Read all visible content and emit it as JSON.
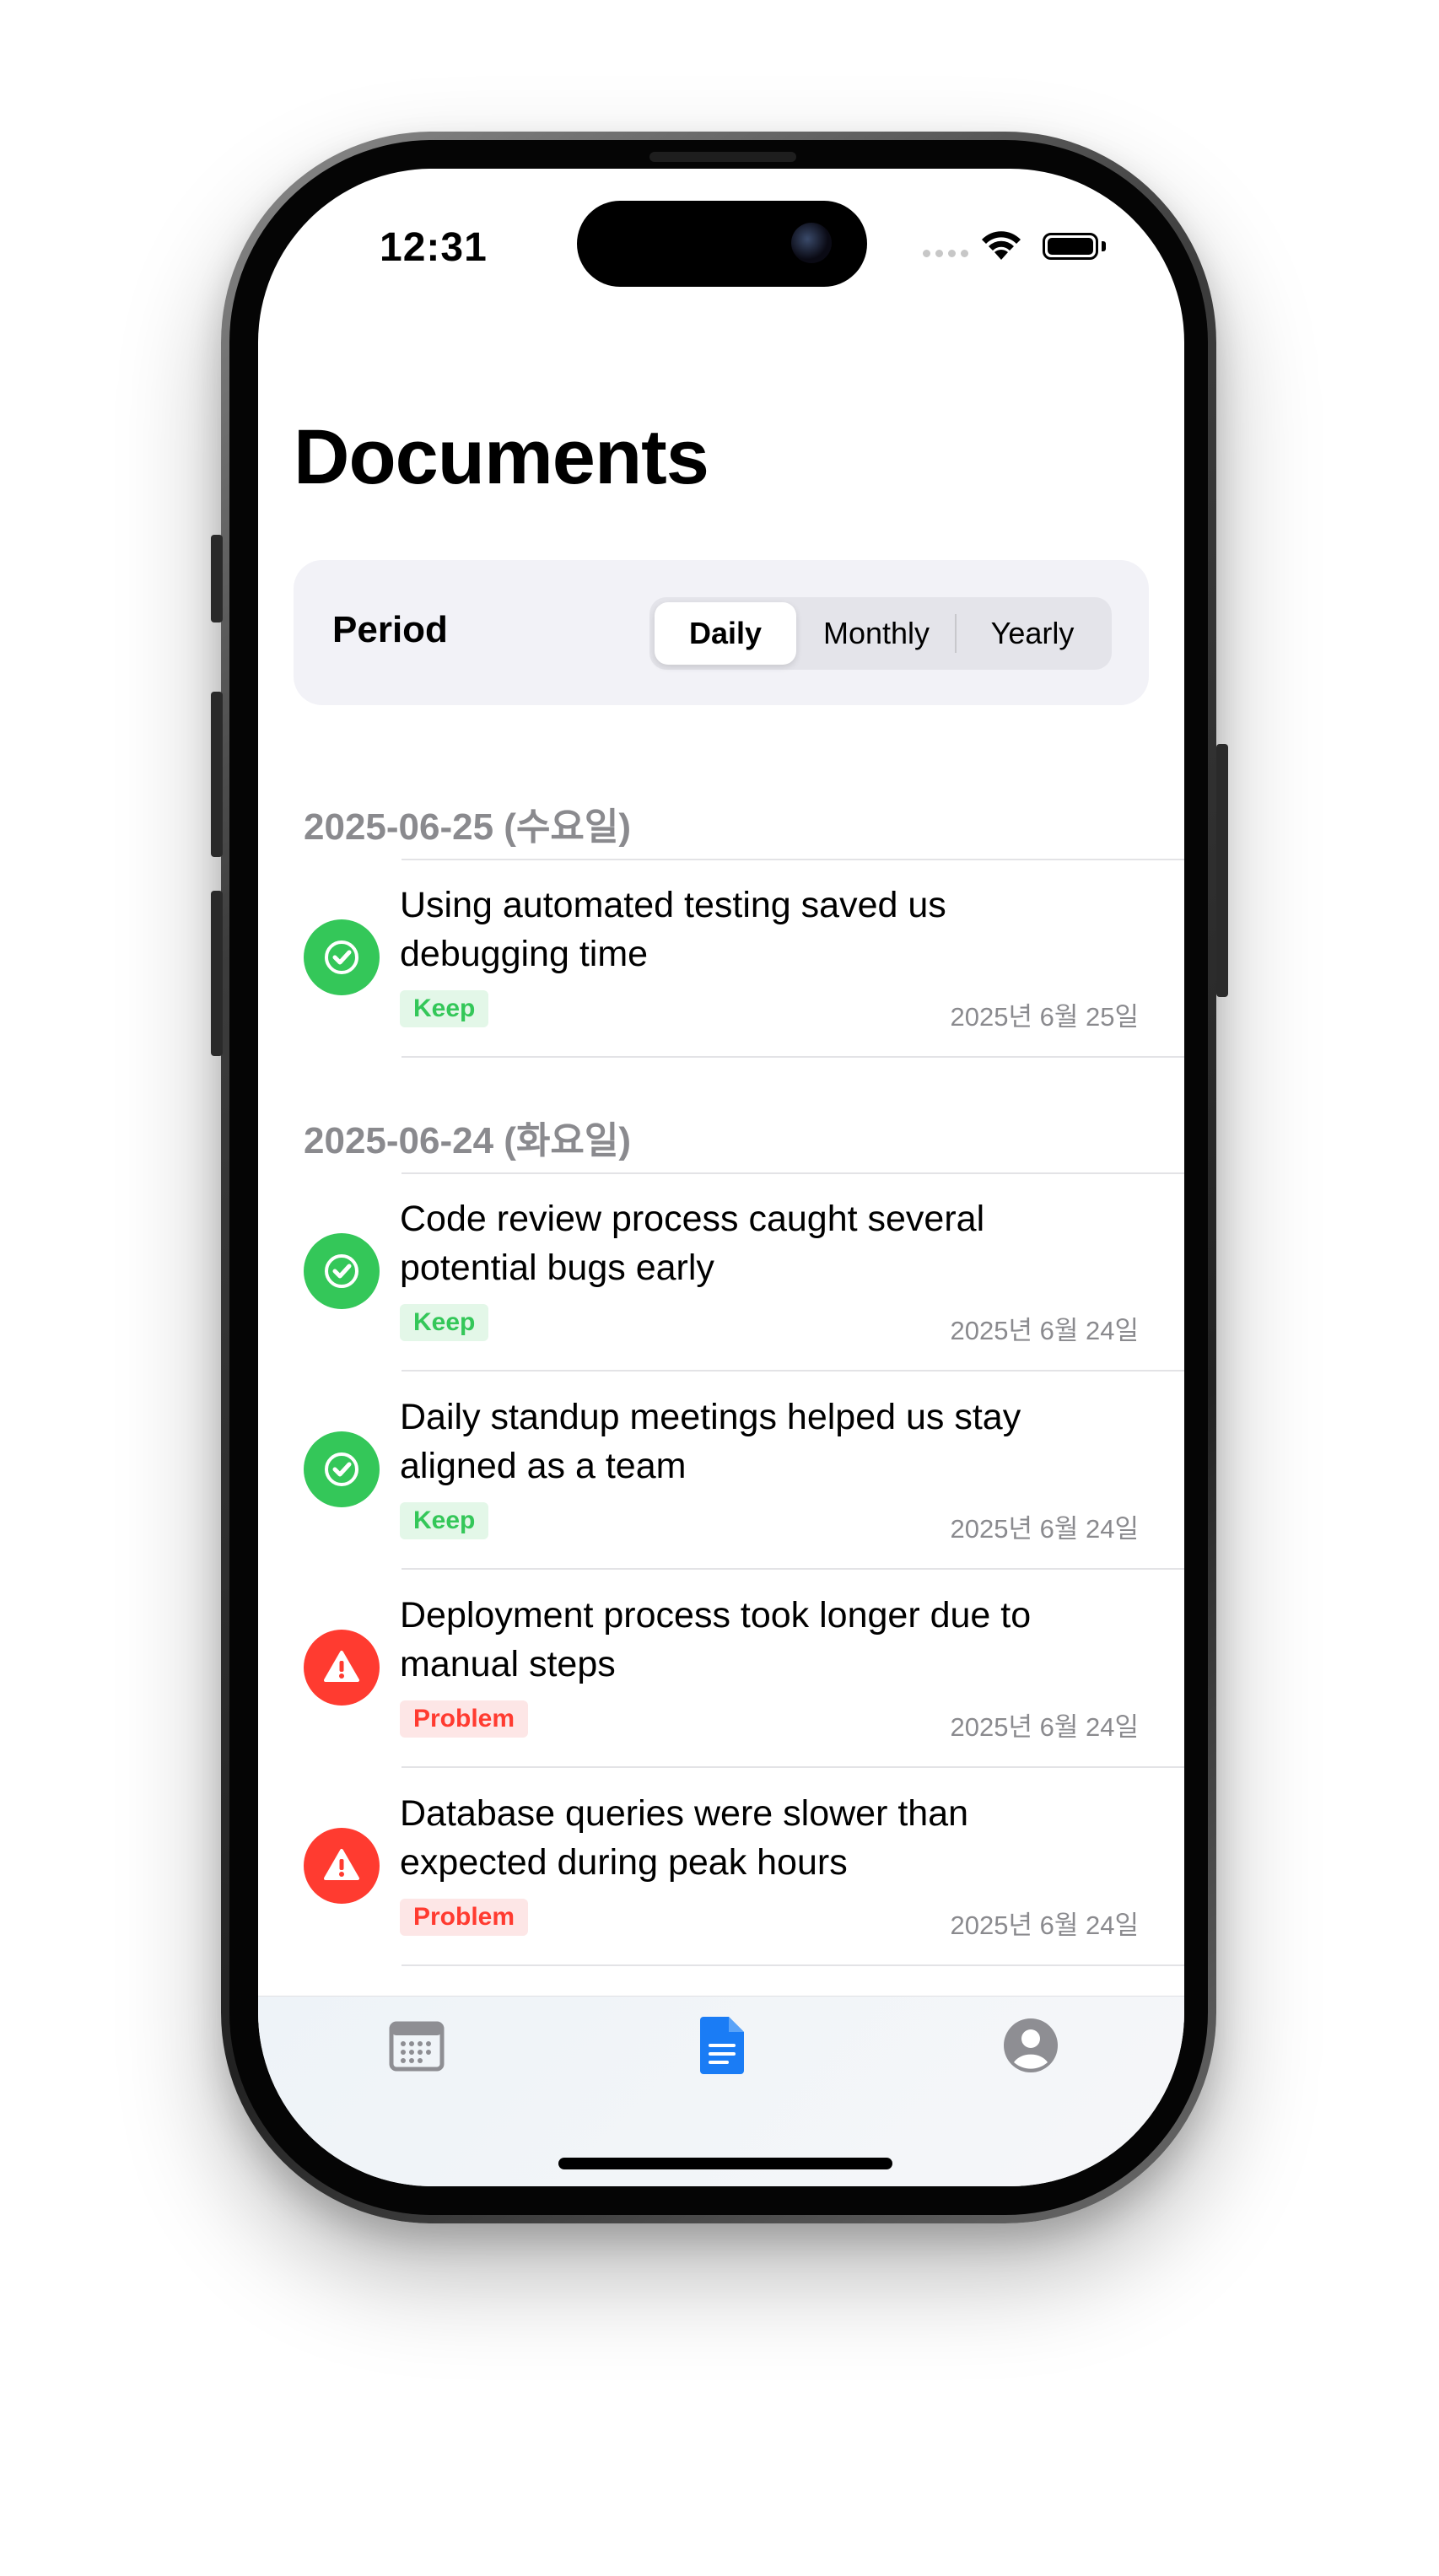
{
  "status_bar": {
    "time": "12:31"
  },
  "header": {
    "title": "Documents"
  },
  "period": {
    "label": "Period",
    "options": [
      "Daily",
      "Monthly",
      "Yearly"
    ],
    "selected": "Daily"
  },
  "sections": [
    {
      "date": "2025-06-25 (수요일)",
      "items": [
        {
          "line1": "Using automated testing saved us",
          "line2": "debugging time",
          "tag": "Keep",
          "type": "keep",
          "date": "2025년 6월 25일",
          "icon": "checkmark-circle-icon"
        }
      ]
    },
    {
      "date": "2025-06-24 (화요일)",
      "items": [
        {
          "line1": "Code review process caught several",
          "line2": "potential bugs early",
          "tag": "Keep",
          "type": "keep",
          "date": "2025년 6월 24일",
          "icon": "checkmark-circle-icon"
        },
        {
          "line1": "Daily standup meetings helped us stay",
          "line2": "aligned as a team",
          "tag": "Keep",
          "type": "keep",
          "date": "2025년 6월 24일",
          "icon": "checkmark-circle-icon"
        },
        {
          "line1": "Deployment process took longer due to",
          "line2": "manual steps",
          "tag": "Problem",
          "type": "problem",
          "date": "2025년 6월 24일",
          "icon": "warning-triangle-icon"
        },
        {
          "line1": "Database queries were slower than",
          "line2": "expected during peak hours",
          "tag": "Problem",
          "type": "problem",
          "date": "2025년 6월 24일",
          "icon": "warning-triangle-icon"
        }
      ]
    }
  ],
  "tab_bar": {
    "tabs": [
      {
        "icon": "calendar-icon",
        "active": false
      },
      {
        "icon": "document-icon",
        "active": true
      },
      {
        "icon": "person-circle-icon",
        "active": false
      }
    ],
    "active_color": "#1a7cf5",
    "inactive_color": "#8e8e93"
  },
  "colors": {
    "keep": "#34c759",
    "problem": "#ff3b30",
    "accent": "#1a7cf5"
  }
}
